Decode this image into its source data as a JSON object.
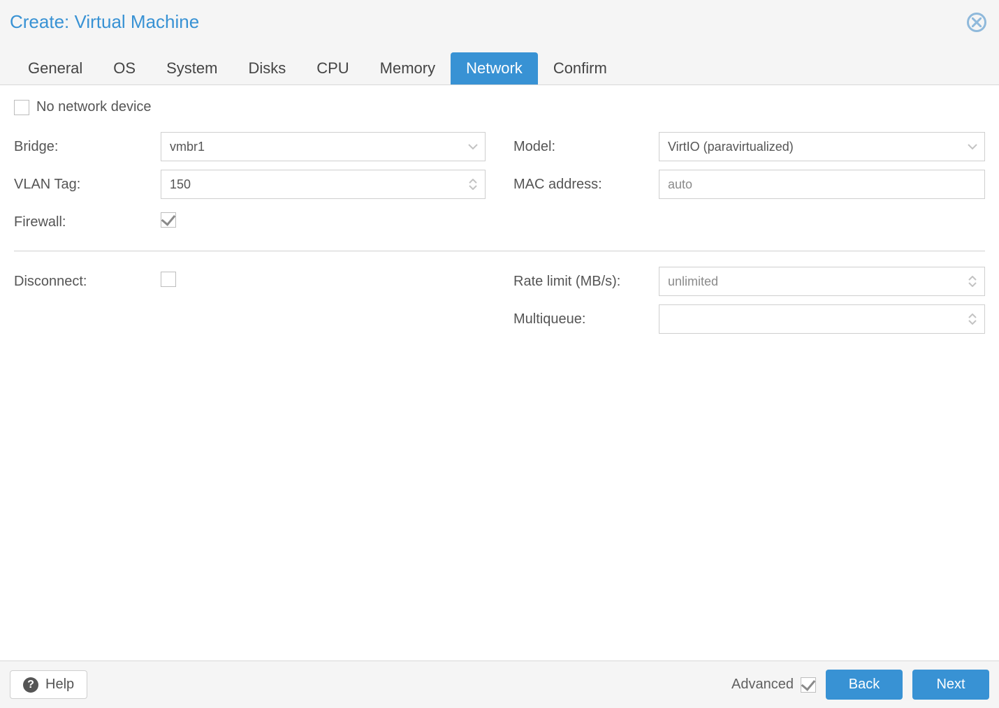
{
  "window": {
    "title": "Create: Virtual Machine"
  },
  "tabs": {
    "general": "General",
    "os": "OS",
    "system": "System",
    "disks": "Disks",
    "cpu": "CPU",
    "memory": "Memory",
    "network": "Network",
    "confirm": "Confirm",
    "active": "network"
  },
  "form": {
    "no_network_device_label": "No network device",
    "no_network_device_checked": false,
    "bridge_label": "Bridge:",
    "bridge_value": "vmbr1",
    "vlan_label": "VLAN Tag:",
    "vlan_value": "150",
    "firewall_label": "Firewall:",
    "firewall_checked": true,
    "model_label": "Model:",
    "model_value": "VirtIO (paravirtualized)",
    "mac_label": "MAC address:",
    "mac_value": "",
    "mac_placeholder": "auto",
    "disconnect_label": "Disconnect:",
    "disconnect_checked": false,
    "rate_label": "Rate limit (MB/s):",
    "rate_value": "",
    "rate_placeholder": "unlimited",
    "multiqueue_label": "Multiqueue:",
    "multiqueue_value": ""
  },
  "footer": {
    "help_label": "Help",
    "advanced_label": "Advanced",
    "advanced_checked": true,
    "back_label": "Back",
    "next_label": "Next"
  }
}
